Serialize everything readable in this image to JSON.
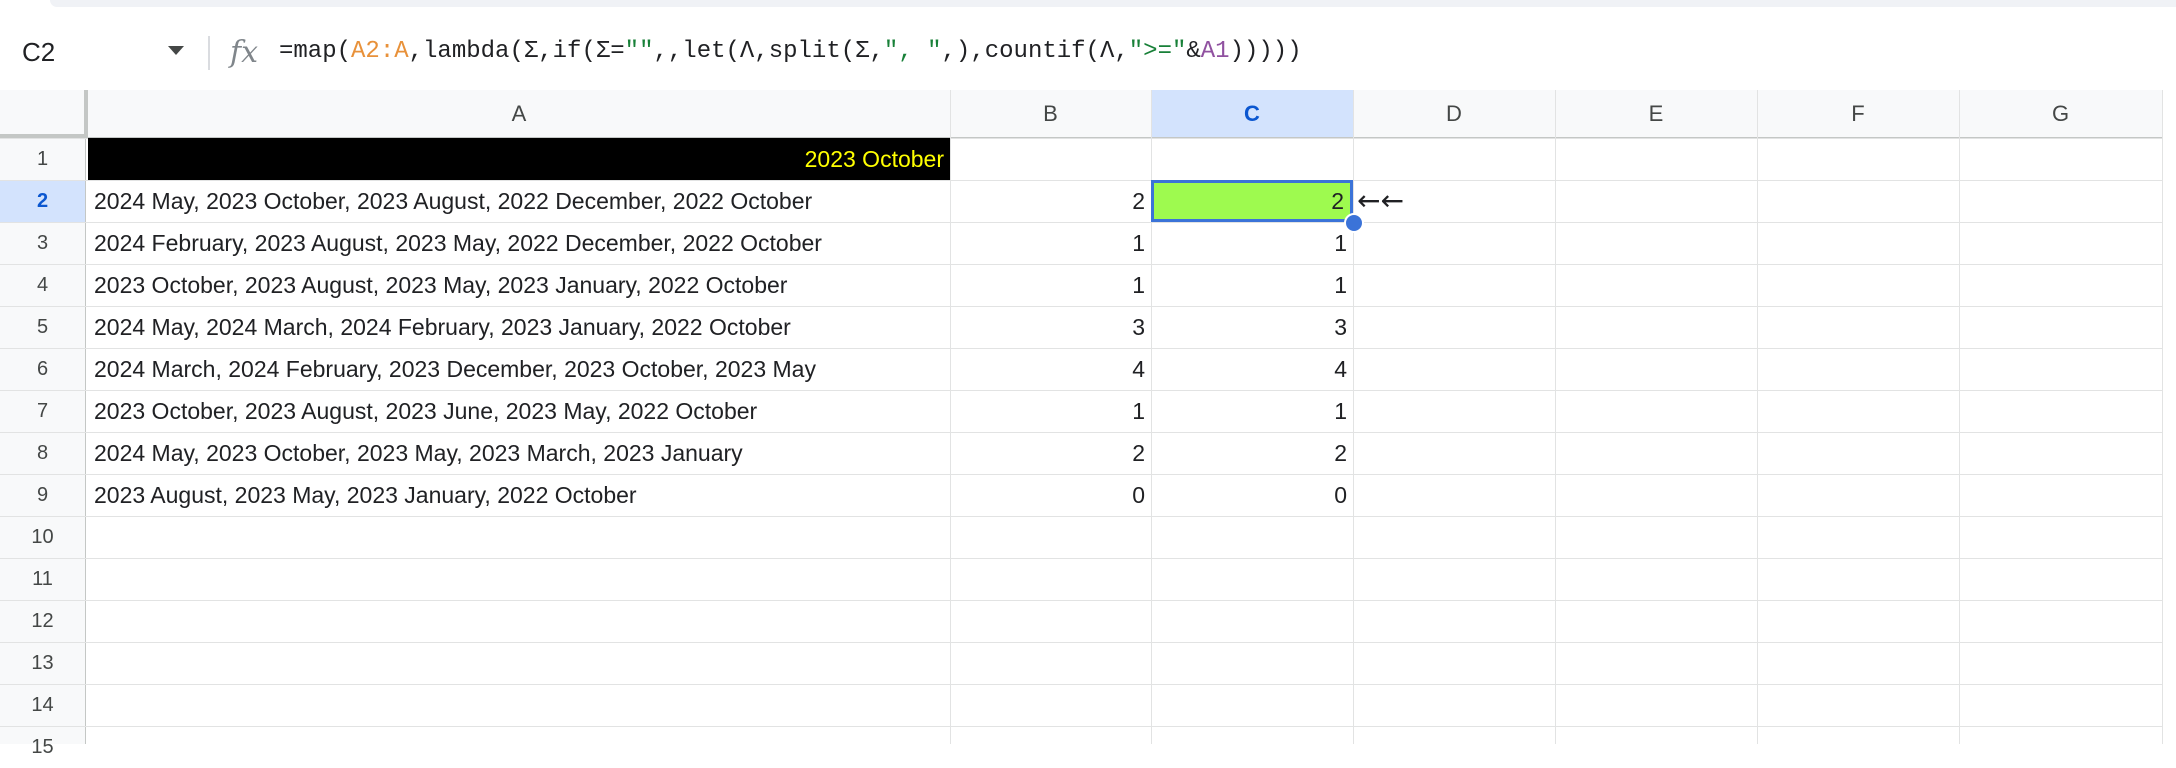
{
  "formula_bar": {
    "name_box": "C2",
    "fx_label": "fx",
    "formula_parts": [
      {
        "text": "=map(",
        "kind": "plain"
      },
      {
        "text": "A2:A",
        "kind": "range-a"
      },
      {
        "text": ",lambda(Σ,if(Σ=",
        "kind": "plain"
      },
      {
        "text": "\"\"",
        "kind": "str"
      },
      {
        "text": ",,let(Λ,split(Σ,",
        "kind": "plain"
      },
      {
        "text": "\", \"",
        "kind": "str"
      },
      {
        "text": ",),countif(Λ,",
        "kind": "plain"
      },
      {
        "text": "\">=\"",
        "kind": "str"
      },
      {
        "text": "&",
        "kind": "plain"
      },
      {
        "text": "A1",
        "kind": "range-b"
      },
      {
        "text": ")))))",
        "kind": "plain"
      }
    ]
  },
  "columns": [
    "A",
    "B",
    "C",
    "D",
    "E",
    "F",
    "G"
  ],
  "selected_column": "C",
  "row_numbers": [
    "1",
    "2",
    "3",
    "4",
    "5",
    "6",
    "7",
    "8",
    "9",
    "10",
    "11",
    "12",
    "13",
    "14",
    "15"
  ],
  "selected_row": "2",
  "cells": {
    "A1": "2023 October",
    "rows": [
      {
        "a": "2024 May, 2023 October, 2023 August, 2022 December, 2022 October",
        "b": "2",
        "c": "2"
      },
      {
        "a": "2024 February, 2023 August, 2023 May, 2022 December, 2022 October",
        "b": "1",
        "c": "1"
      },
      {
        "a": "2023 October, 2023 August, 2023 May, 2023 January, 2022 October",
        "b": "1",
        "c": "1"
      },
      {
        "a": "2024 May, 2024 March, 2024 February, 2023 January, 2022 October",
        "b": "3",
        "c": "3"
      },
      {
        "a": "2024 March, 2024 February, 2023 December, 2023 October, 2023 May",
        "b": "4",
        "c": "4"
      },
      {
        "a": "2023 October, 2023 August, 2023 June, 2023 May, 2022 October",
        "b": "1",
        "c": "1"
      },
      {
        "a": "2024 May, 2023 October, 2023 May, 2023 March, 2023 January",
        "b": "2",
        "c": "2"
      },
      {
        "a": "2023 August, 2023 May, 2023 January, 2022 October",
        "b": "0",
        "c": "0"
      }
    ]
  },
  "annotation_arrow": "←←",
  "colors": {
    "a1_bg": "#000000",
    "a1_text": "#ffff00",
    "c2_fill": "#9efa4f",
    "selection": "#3b73d8",
    "header_selected": "#d3e3fd"
  }
}
